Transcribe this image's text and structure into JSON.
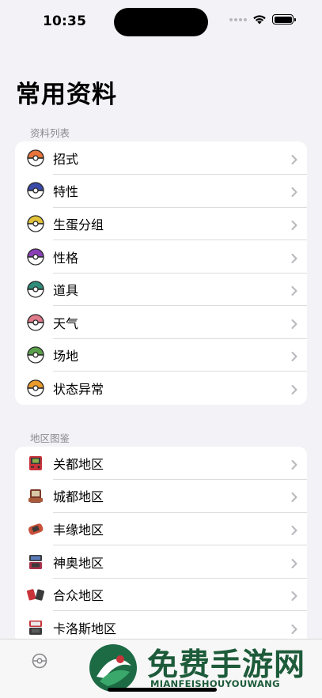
{
  "status_bar": {
    "time": "10:35"
  },
  "page_title": "常用资料",
  "sections": [
    {
      "header": "资料列表",
      "items": [
        {
          "label": "招式",
          "icon": "poke-ball-orange-icon",
          "color": "#e8743a"
        },
        {
          "label": "特性",
          "icon": "poke-ball-navy-icon",
          "color": "#3a4aa8"
        },
        {
          "label": "生蛋分组",
          "icon": "poke-ball-yellow-icon",
          "color": "#e2c23a"
        },
        {
          "label": "性格",
          "icon": "poke-ball-purple-icon",
          "color": "#8a3fb8"
        },
        {
          "label": "道具",
          "icon": "poke-ball-teal-icon",
          "color": "#2f8c7a"
        },
        {
          "label": "天气",
          "icon": "poke-ball-pink-icon",
          "color": "#e07a8a"
        },
        {
          "label": "场地",
          "icon": "poke-ball-green-icon",
          "color": "#5aa04a"
        },
        {
          "label": "状态异常",
          "icon": "poke-ball-amber-icon",
          "color": "#e89a2a"
        }
      ]
    },
    {
      "header": "地区图鉴",
      "items": [
        {
          "label": "关都地区",
          "icon": "gameboy-red-icon",
          "color": "#c8343a"
        },
        {
          "label": "城都地区",
          "icon": "gameboy-color-icon",
          "color": "#7a3a2a"
        },
        {
          "label": "丰缘地区",
          "icon": "gameboy-advance-icon",
          "color": "#c8503a"
        },
        {
          "label": "神奥地区",
          "icon": "nintendo-ds-icon",
          "color": "#a8324a"
        },
        {
          "label": "合众地区",
          "icon": "nintendo-ds-pair-icon",
          "color": "#c8343a"
        },
        {
          "label": "卡洛斯地区",
          "icon": "nintendo-3ds-icon",
          "color": "#c8343a"
        }
      ]
    }
  ],
  "watermark": {
    "title": "免费手游网",
    "subtitle": "MIANFEISHOUYOUWANG"
  },
  "colors": {
    "background": "#f2f2f7",
    "card": "#ffffff",
    "secondary_text": "#8a8a8e",
    "chevron": "#b8b8bc"
  }
}
